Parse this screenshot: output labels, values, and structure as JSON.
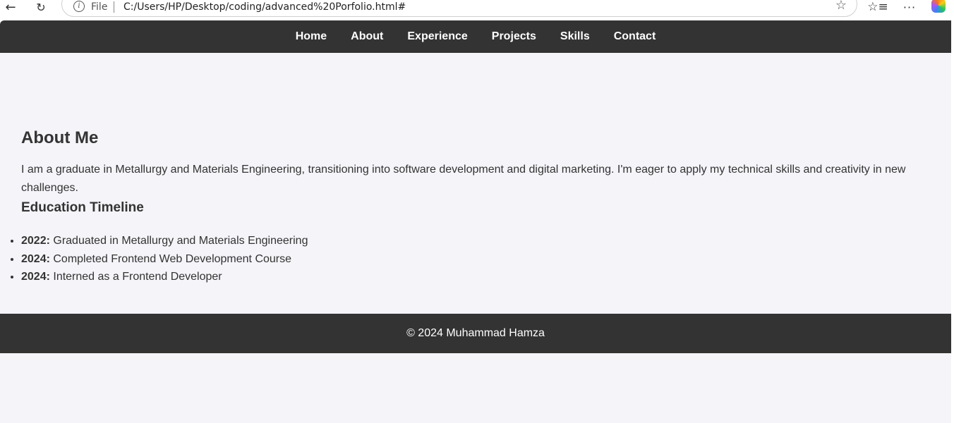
{
  "browser": {
    "address_scheme": "File",
    "url": "C:/Users/HP/Desktop/coding/advanced%20Porfolio.html#"
  },
  "nav": {
    "items": [
      {
        "label": "Home"
      },
      {
        "label": "About"
      },
      {
        "label": "Experience"
      },
      {
        "label": "Projects"
      },
      {
        "label": "Skills"
      },
      {
        "label": "Contact"
      }
    ]
  },
  "about": {
    "title": "About Me",
    "text": "I am a graduate in Metallurgy and Materials Engineering, transitioning into software development and digital marketing. I'm eager to apply my technical skills and creativity in new challenges.",
    "education_title": "Education Timeline",
    "timeline": [
      {
        "year": "2022:",
        "text": " Graduated in Metallurgy and Materials Engineering"
      },
      {
        "year": "2024:",
        "text": " Completed Frontend Web Development Course"
      },
      {
        "year": "2024:",
        "text": " Interned as a Frontend Developer"
      }
    ]
  },
  "footer": {
    "text": "© 2024 Muhammad Hamza"
  },
  "colors": {
    "nav_bg": "#333333",
    "page_bg": "#f4f4f9",
    "text": "#333333"
  }
}
